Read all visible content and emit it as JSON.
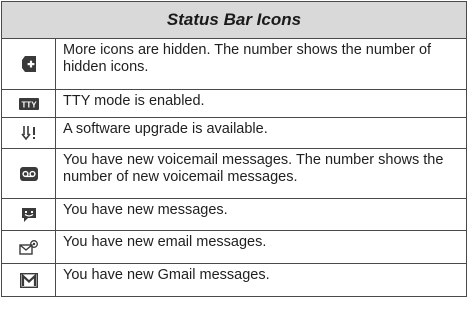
{
  "table": {
    "title": "Status Bar Icons",
    "rows": [
      {
        "icon": "more-icons-hidden-icon",
        "text": "More icons are hidden. The number shows the number of hidden icons."
      },
      {
        "icon": "tty-icon",
        "icon_text": "TTY",
        "text": "TTY mode is enabled."
      },
      {
        "icon": "software-upgrade-icon",
        "text": "A software upgrade is available."
      },
      {
        "icon": "voicemail-icon",
        "text": "You have new voicemail messages. The number shows the number of new voicemail messages."
      },
      {
        "icon": "message-icon",
        "text": "You have new messages."
      },
      {
        "icon": "email-icon",
        "text": "You have new email messages."
      },
      {
        "icon": "gmail-icon",
        "text": "You have new Gmail messages."
      }
    ]
  },
  "colors": {
    "header_bg": "#d9d9d9",
    "border": "#4a4a4a",
    "icon_dark": "#3a3a3a"
  }
}
